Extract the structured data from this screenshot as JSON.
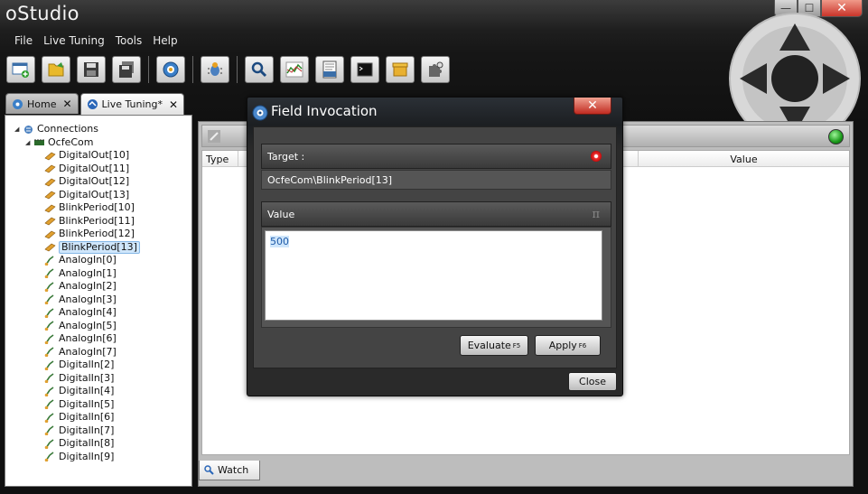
{
  "app": {
    "title": "oStudio"
  },
  "window_controls": {
    "minimize": "—",
    "maximize": "☐",
    "close": "✕"
  },
  "menu": [
    "File",
    "Live Tuning",
    "Tools",
    "Help"
  ],
  "toolbar_icons": [
    "new-connection-icon",
    "open-folder-icon",
    "save-icon",
    "save-all-icon",
    "settings-icon",
    "bug-icon",
    "search-icon",
    "chart-icon",
    "log-icon",
    "terminal-icon",
    "package-icon",
    "plugin-icon"
  ],
  "tabs": [
    {
      "label": "Home",
      "close": "✕"
    },
    {
      "label": "Live Tuning*",
      "close": "✕"
    }
  ],
  "tree": {
    "root": "Connections",
    "device": "OcfeCom",
    "items": [
      "DigitalOut[10]",
      "DigitalOut[11]",
      "DigitalOut[12]",
      "DigitalOut[13]",
      "BlinkPeriod[10]",
      "BlinkPeriod[11]",
      "BlinkPeriod[12]",
      "BlinkPeriod[13]",
      "AnalogIn[0]",
      "AnalogIn[1]",
      "AnalogIn[2]",
      "AnalogIn[3]",
      "AnalogIn[4]",
      "AnalogIn[5]",
      "AnalogIn[6]",
      "AnalogIn[7]",
      "DigitalIn[2]",
      "DigitalIn[3]",
      "DigitalIn[4]",
      "DigitalIn[5]",
      "DigitalIn[6]",
      "DigitalIn[7]",
      "DigitalIn[8]",
      "DigitalIn[9]"
    ],
    "selected": "BlinkPeriod[13]"
  },
  "watch": {
    "columns": {
      "type": "Type",
      "value": "Value"
    },
    "tab_label": "Watch"
  },
  "dialog": {
    "title": "Field Invocation",
    "close_glyph": "✕",
    "target_label": "Target :",
    "target_value": "OcfeCom\\BlinkPeriod[13]",
    "value_label": "Value",
    "pi_glyph": "π",
    "value": "500",
    "evaluate_label": "Evaluate",
    "evaluate_key": "F5",
    "apply_label": "Apply",
    "apply_key": "F6",
    "close_label": "Close"
  }
}
